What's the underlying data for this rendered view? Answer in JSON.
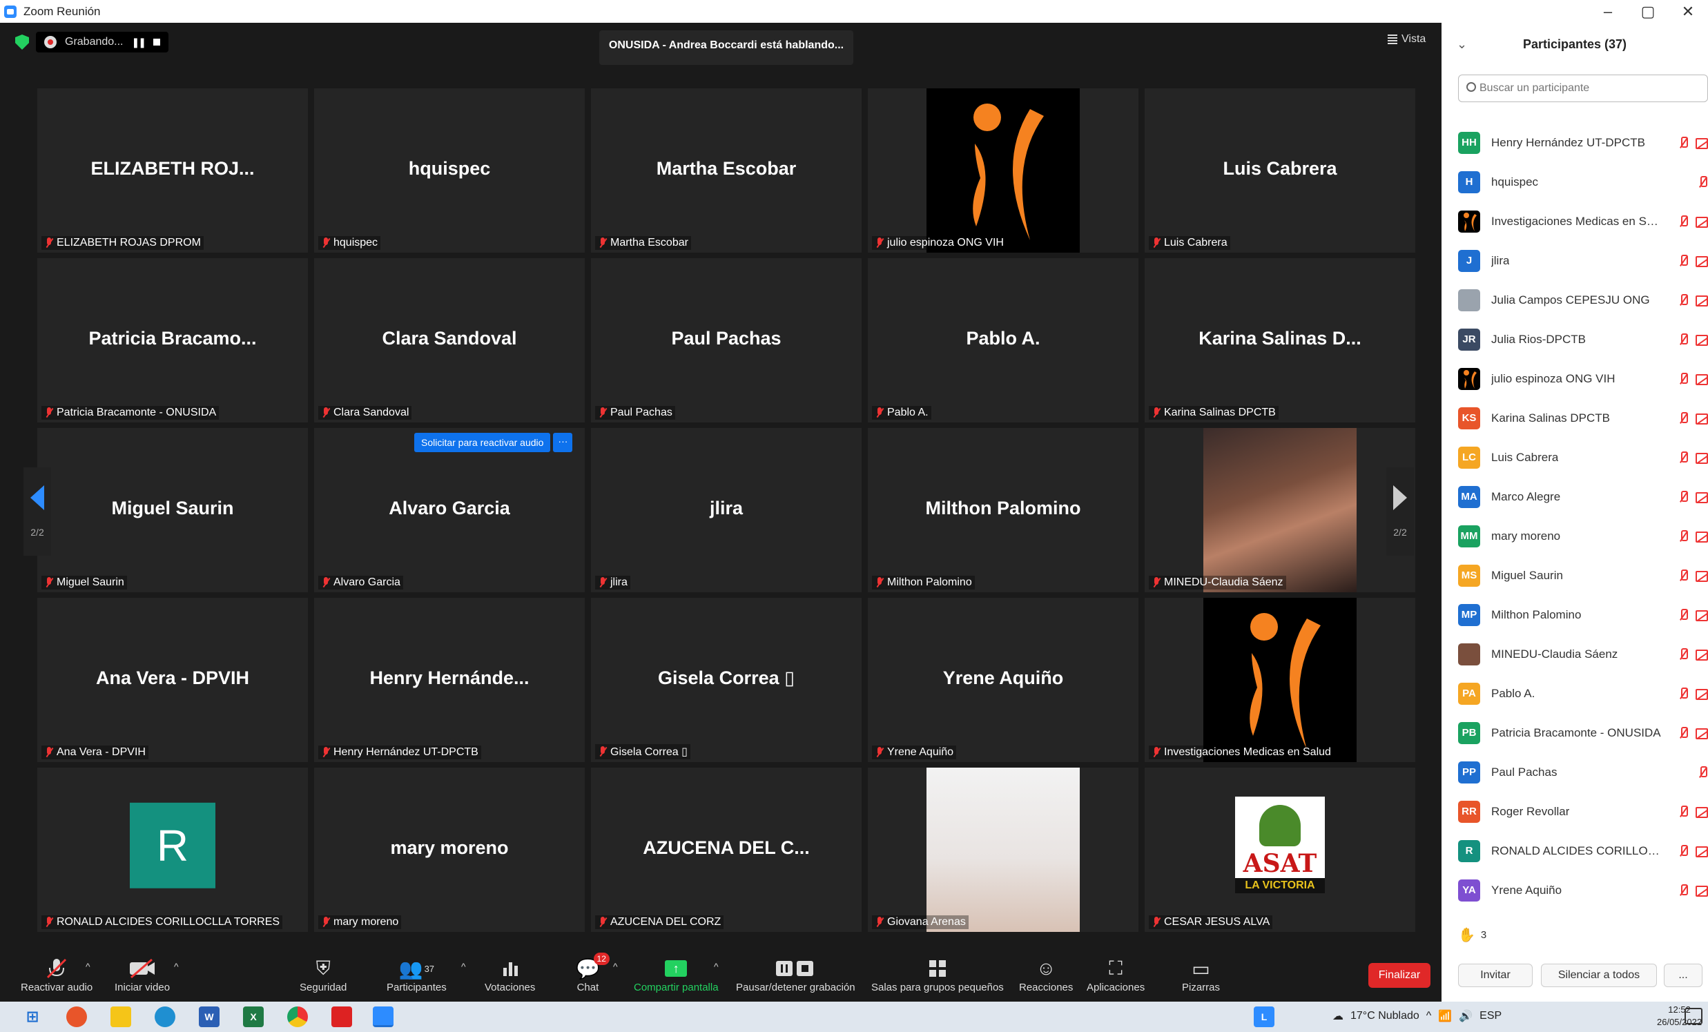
{
  "window": {
    "title": "Zoom Reunión",
    "controls": [
      "–",
      "▢",
      "✕"
    ]
  },
  "topbar": {
    "recording_label": "Grabando...",
    "speaking_banner": "ONUSIDA - Andrea Boccardi está hablando...",
    "view_label": "Vista"
  },
  "tiles": [
    {
      "big": "ELIZABETH ROJ...",
      "name": "ELIZABETH ROJAS DPROM"
    },
    {
      "big": "hquispec",
      "name": "hquispec"
    },
    {
      "big": "Martha Escobar",
      "name": "Martha Escobar"
    },
    {
      "big": "",
      "name": "julio espinoza ONG VIH"
    },
    {
      "big": "Luis Cabrera",
      "name": "Luis Cabrera"
    },
    {
      "big": "Patricia Bracamo...",
      "name": "Patricia Bracamonte - ONUSIDA"
    },
    {
      "big": "Clara Sandoval",
      "name": "Clara Sandoval"
    },
    {
      "big": "Paul Pachas",
      "name": "Paul Pachas"
    },
    {
      "big": "Pablo A.",
      "name": "Pablo A."
    },
    {
      "big": "Karina Salinas D...",
      "name": "Karina Salinas DPCTB"
    },
    {
      "big": "Miguel Saurin",
      "name": "Miguel Saurin"
    },
    {
      "big": "Alvaro Garcia",
      "name": "Alvaro Garcia"
    },
    {
      "big": "jlira",
      "name": "jlira"
    },
    {
      "big": "Milthon Palomino",
      "name": "Milthon Palomino"
    },
    {
      "big": "",
      "name": "MINEDU-Claudia Sáenz"
    },
    {
      "big": "Ana Vera - DPVIH",
      "name": "Ana Vera - DPVIH"
    },
    {
      "big": "Henry Hernánde...",
      "name": "Henry Hernández UT-DPCTB"
    },
    {
      "big": "Gisela Correa ▯",
      "name": "Gisela Correa ▯"
    },
    {
      "big": "Yrene Aquiño",
      "name": "Yrene Aquiño"
    },
    {
      "big": "",
      "name": "Investigaciones Medicas en Salud"
    },
    {
      "big": "R",
      "name": "RONALD ALCIDES CORILLOCLLA TORRES"
    },
    {
      "big": "mary moreno",
      "name": "mary moreno"
    },
    {
      "big": "AZUCENA DEL C...",
      "name": "AZUCENA DEL CORZ"
    },
    {
      "big": "",
      "name": "Giovana Arenas"
    },
    {
      "big": "",
      "name": "CESAR JESUS ALVA"
    }
  ],
  "unmute_request": {
    "label": "Solicitar para reactivar audio",
    "more": "···"
  },
  "pager": {
    "left_page": "2/2",
    "right_page": "2/2"
  },
  "asat_logo": {
    "line1": "ASAT",
    "line2": "LA VICTORIA"
  },
  "toolbar": {
    "unmute": "Reactivar audio",
    "start_video": "Iniciar video",
    "security": "Seguridad",
    "participants": "Participantes",
    "participants_count": "37",
    "polls": "Votaciones",
    "chat": "Chat",
    "chat_badge": "12",
    "share": "Compartir pantalla",
    "pause_record": "Pausar/detener grabación",
    "breakout": "Salas para grupos pequeños",
    "reactions": "Reacciones",
    "apps": "Aplicaciones",
    "whiteboards": "Pizarras",
    "end": "Finalizar"
  },
  "panel": {
    "title": "Participantes (37)",
    "search_placeholder": "Buscar un participante",
    "participants": [
      {
        "initials": "HH",
        "color": "#1aa260",
        "name": "Henry Hernández UT-DPCTB"
      },
      {
        "initials": "H",
        "color": "#1f6fd1",
        "name": "hquispec"
      },
      {
        "initials": "",
        "color": "#000000",
        "name": "Investigaciones Medicas en Sal..."
      },
      {
        "initials": "J",
        "color": "#1f6fd1",
        "name": "jlira"
      },
      {
        "initials": "",
        "color": "#9aa3ad",
        "name": "Julia Campos CEPESJU ONG"
      },
      {
        "initials": "JR",
        "color": "#3b4a63",
        "name": "Julia Rios-DPCTB"
      },
      {
        "initials": "",
        "color": "#000000",
        "name": "julio espinoza ONG VIH"
      },
      {
        "initials": "KS",
        "color": "#e8552a",
        "name": "Karina Salinas DPCTB"
      },
      {
        "initials": "LC",
        "color": "#f5a623",
        "name": "Luis Cabrera"
      },
      {
        "initials": "MA",
        "color": "#1f6fd1",
        "name": "Marco Alegre"
      },
      {
        "initials": "MM",
        "color": "#1aa260",
        "name": "mary moreno"
      },
      {
        "initials": "MS",
        "color": "#f5a623",
        "name": "Miguel Saurin"
      },
      {
        "initials": "MP",
        "color": "#1f6fd1",
        "name": "Milthon Palomino"
      },
      {
        "initials": "",
        "color": "#7a4f3d",
        "name": "MINEDU-Claudia Sáenz"
      },
      {
        "initials": "PA",
        "color": "#f5a623",
        "name": "Pablo A."
      },
      {
        "initials": "PB",
        "color": "#1aa260",
        "name": "Patricia Bracamonte - ONUSIDA"
      },
      {
        "initials": "PP",
        "color": "#1f6fd1",
        "name": "Paul Pachas"
      },
      {
        "initials": "RR",
        "color": "#e8552a",
        "name": "Roger Revollar"
      },
      {
        "initials": "R",
        "color": "#14917f",
        "name": "RONALD ALCIDES CORILLOCLL..."
      },
      {
        "initials": "YA",
        "color": "#7e4fd1",
        "name": "Yrene Aquiño"
      }
    ],
    "raised_hands": "3",
    "invite": "Invitar",
    "mute_all": "Silenciar a todos",
    "more": "..."
  },
  "taskbar": {
    "weather": "17°C Nublado",
    "lang": "ESP",
    "time": "12:52",
    "date": "26/05/2022"
  },
  "colors": {
    "accent_blue": "#0e72ed",
    "end_red": "#e02828",
    "share_green": "#23d160",
    "orange_logo": "#f58220"
  }
}
